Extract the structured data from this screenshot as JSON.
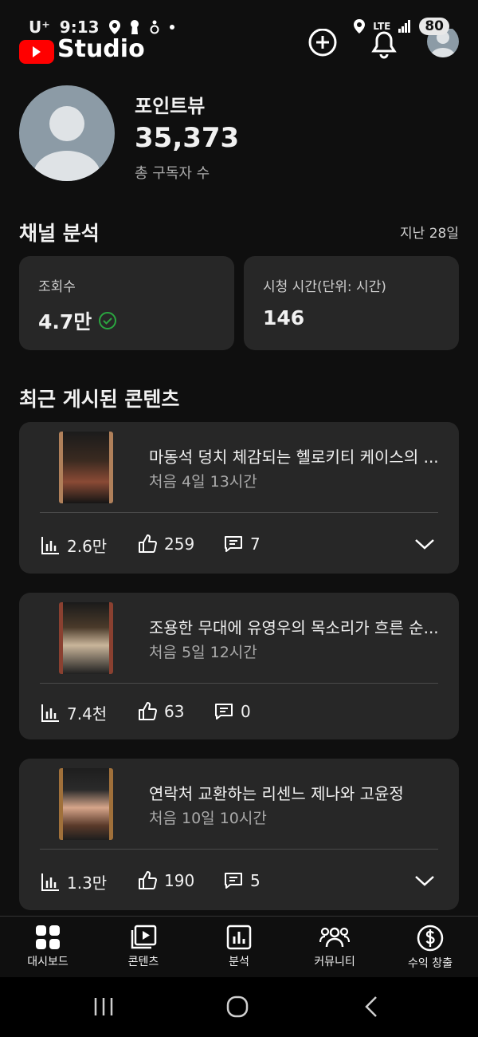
{
  "status_bar": {
    "carrier": "U⁺",
    "time": "9:13",
    "network": "LTE",
    "battery": "80"
  },
  "app": {
    "logo_text": "Studio"
  },
  "channel": {
    "name": "포인트뷰",
    "subscribers": "35,373",
    "subscribers_label": "총 구독자 수"
  },
  "analytics": {
    "title": "채널 분석",
    "period": "지난 28일",
    "views_label": "조회수",
    "views_value": "4.7만",
    "watch_label": "시청 시간(단위: 시간)",
    "watch_value": "146"
  },
  "recent": {
    "title": "최근 게시된 콘텐츠",
    "videos": [
      {
        "title": "마동석 덩치 체감되는 헬로키티 케이스의 ...",
        "meta": "처음 4일 13시간",
        "views": "2.6만",
        "likes": "259",
        "comments": "7"
      },
      {
        "title": "조용한 무대에 유영우의 목소리가 흐른 순...",
        "meta": "처음 5일 12시간",
        "views": "7.4천",
        "likes": "63",
        "comments": "0"
      },
      {
        "title": "연락처 교환하는 리센느 제나와 고윤정",
        "meta": "처음 10일 10시간",
        "views": "1.3만",
        "likes": "190",
        "comments": "5"
      }
    ]
  },
  "nav": {
    "dashboard": "대시보드",
    "content": "콘텐츠",
    "analytics": "분석",
    "community": "커뮤니티",
    "monetization": "수익 창출"
  },
  "colors": {
    "background": "#0f0f0f",
    "card": "#272727",
    "accent_red": "#ff0000",
    "check_green": "#2ba640"
  }
}
